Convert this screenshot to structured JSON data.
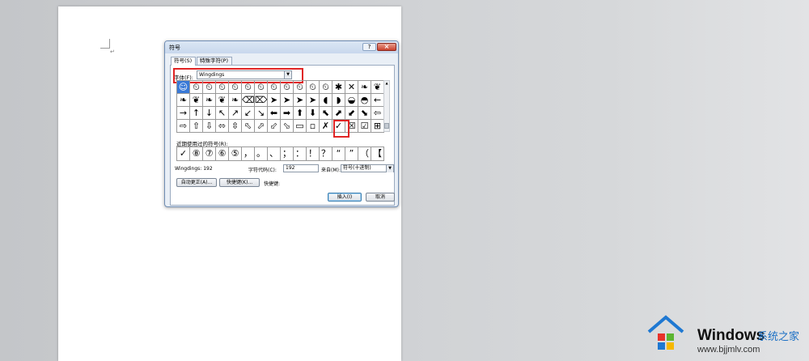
{
  "dialog": {
    "title": "符号",
    "help_label": "?",
    "close_label": "×",
    "tabs": [
      {
        "label": "符号(S)"
      },
      {
        "label": "特殊字符(P)"
      }
    ],
    "font_label": "字体(F):",
    "font_value": "Wingdings",
    "symbol_rows": [
      [
        "☺",
        "⏲",
        "⏲",
        "⏲",
        "⏲",
        "⏲",
        "⏲",
        "⏲",
        "⏲",
        "⏲",
        "⏲",
        "⏲",
        "✱",
        "✕",
        "❧",
        "❦"
      ],
      [
        "❧",
        "❦",
        "❧",
        "❦",
        "❧",
        "⌫",
        "⌦",
        "➤",
        "➤",
        "➤",
        "➤",
        "◖",
        "◗",
        "◒",
        "◓",
        "←"
      ],
      [
        "→",
        "↑",
        "↓",
        "↖",
        "↗",
        "↙",
        "↘",
        "⬅",
        "➡",
        "⬆",
        "⬇",
        "⬉",
        "⬈",
        "⬋",
        "⬊",
        "⇦"
      ],
      [
        "⇨",
        "⇧",
        "⇩",
        "⬄",
        "⇳",
        "⬁",
        "⬀",
        "⬃",
        "⬂",
        "▭",
        "▫",
        "✗",
        "✓",
        "☒",
        "☑",
        "⊞"
      ]
    ],
    "recent_label": "近期使用过的符号(R):",
    "recent_symbols": [
      "✓",
      "⑧",
      "⑦",
      "⑥",
      "⑤",
      "，",
      "。",
      "、",
      "；",
      "：",
      "！",
      "？",
      "“",
      "”",
      "（",
      "【"
    ],
    "char_name": "Wingdings: 192",
    "char_code_label": "字符代码(C):",
    "char_code_value": "192",
    "from_label": "来自(M):",
    "from_value": "符号(十进制)",
    "autocorrect_label": "自动更正(A)...",
    "shortcut_key_label": "快捷键(K)...",
    "shortcut_text": "快捷键:",
    "insert_label": "插入(I)",
    "cancel_label": "取消"
  },
  "document": {
    "paragraph_mark": "↵"
  },
  "watermark": {
    "title": "Windows",
    "subtitle": "系统之家",
    "url": "www.bjjmlv.com",
    "colors": {
      "red": "#e8322a",
      "green": "#5cb531",
      "blue": "#1e78d2",
      "yellow": "#f6b800"
    }
  }
}
